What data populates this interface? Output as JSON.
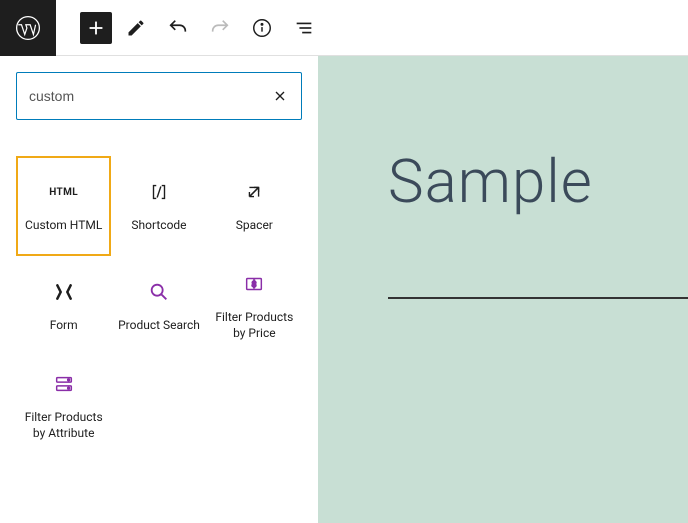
{
  "search": {
    "value": "custom"
  },
  "blocks": [
    {
      "label": "Custom HTML"
    },
    {
      "label": "Shortcode"
    },
    {
      "label": "Spacer"
    },
    {
      "label": "Form"
    },
    {
      "label": "Product Search"
    },
    {
      "label": "Filter Products by Price"
    },
    {
      "label": "Filter Products by Attribute"
    }
  ],
  "preview": {
    "title": "Sample"
  }
}
